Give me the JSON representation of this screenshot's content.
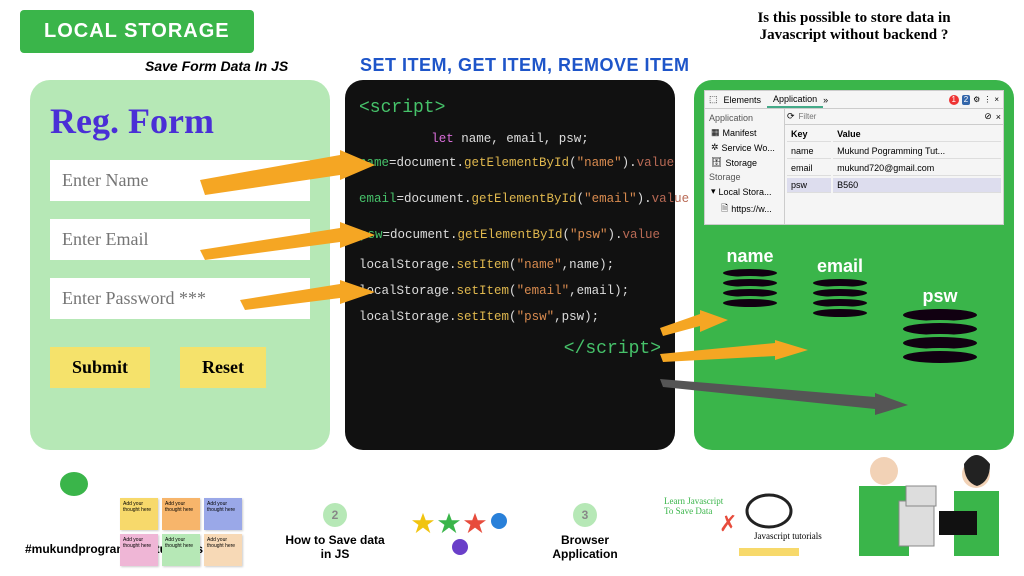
{
  "title": "LOCAL STORAGE",
  "subtitle": "Save Form Data In JS",
  "methods": "SET ITEM, GET ITEM, REMOVE ITEM",
  "question": "Is this possible to store data in Javascript without backend ?",
  "form": {
    "title": "Reg. Form",
    "name_ph": "Enter Name",
    "email_ph": "Enter Email",
    "psw_ph": "Enter Password ***",
    "submit": "Submit",
    "reset": "Reset"
  },
  "code": {
    "open": "<script>",
    "l1a": "let",
    "l1b": " name, email, psw;",
    "l2a": "name",
    "l2b": "=document.",
    "l2c": "getElementById",
    "l2d": "(",
    "l2e": "\"name\"",
    "l2f": ").",
    "l2g": "value",
    "l3a": "email",
    "l3b": "=document.",
    "l3c": "getElementById",
    "l3d": "(",
    "l3e": "\"email\"",
    "l3f": ").",
    "l3g": "value",
    "l4a": "psw",
    "l4b": "=document.",
    "l4c": "getElementById",
    "l4d": "(",
    "l4e": "\"psw\"",
    "l4f": ").",
    "l4g": "value",
    "l5a": "localStorage.",
    "l5b": "setItem",
    "l5c": "(",
    "l5d": "\"name\"",
    "l5e": ",name);",
    "l6a": "localStorage.",
    "l6b": "setItem",
    "l6c": "(",
    "l6d": "\"email\"",
    "l6e": ",email);",
    "l7a": "localStorage.",
    "l7b": "setItem",
    "l7c": "(",
    "l7d": "\"psw\"",
    "l7e": ",psw);",
    "close": "</script>"
  },
  "devtools": {
    "tabs": [
      "Elements",
      "Application"
    ],
    "badge_red": "1",
    "badge_blue": "2",
    "section": "Application",
    "items": [
      "Manifest",
      "Service Wo...",
      "Storage"
    ],
    "section2": "Storage",
    "items2": [
      "Local Stora...",
      "https://w..."
    ],
    "filter_ph": "Filter",
    "cols": [
      "Key",
      "Value"
    ],
    "rows": [
      {
        "k": "name",
        "v": "Mukund Pogramming Tut..."
      },
      {
        "k": "email",
        "v": "mukund720@gmail.com"
      },
      {
        "k": "psw",
        "v": "B560"
      }
    ]
  },
  "db_labels": [
    "name",
    "email",
    "psw"
  ],
  "footer": {
    "hashtag": "#mukundprogrammingtutorials",
    "note_text": "Add your thought here",
    "step2_num": "2",
    "step2": "How to Save data in JS",
    "step3_num": "3",
    "step3": "Browser Application",
    "deco1": "Learn Javascript To Save Data",
    "deco2": "Javascript tutorials"
  }
}
